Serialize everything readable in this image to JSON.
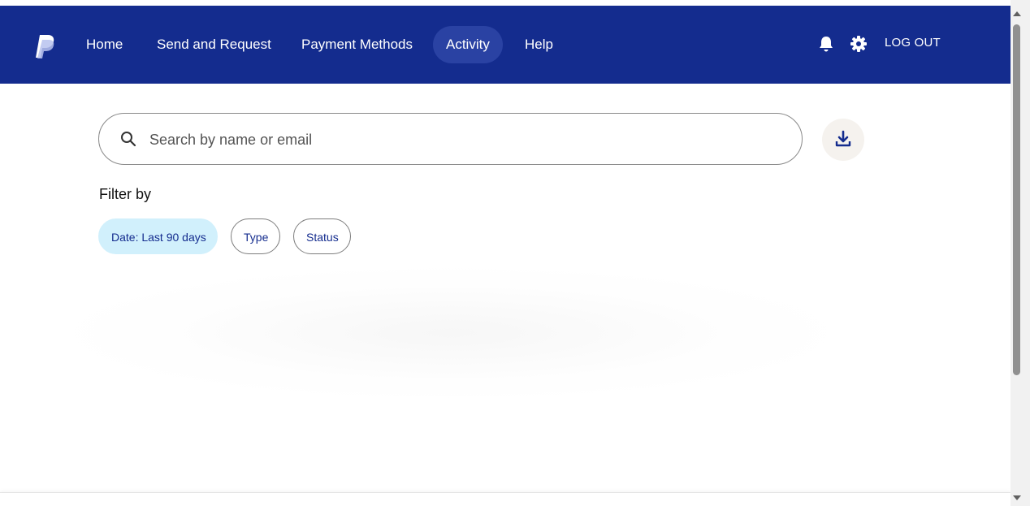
{
  "nav": {
    "logo_icon": "paypal-logo-icon",
    "items": [
      {
        "label": "Home"
      },
      {
        "label": "Send and Request"
      },
      {
        "label": "Payment Methods"
      },
      {
        "label": "Activity",
        "active": true
      },
      {
        "label": "Help"
      }
    ],
    "notification_icon": "bell-icon",
    "settings_icon": "gear-icon",
    "logout_label": "LOG OUT",
    "brand_color": "#142c8e",
    "active_color": "#2a42a3"
  },
  "search": {
    "placeholder": "Search by name or email",
    "value": "",
    "icon": "search-icon"
  },
  "download": {
    "icon": "download-icon"
  },
  "filters": {
    "label": "Filter by",
    "chips": [
      {
        "label": "Date: Last 90 days",
        "selected": true
      },
      {
        "label": "Type",
        "selected": false
      },
      {
        "label": "Status",
        "selected": false
      }
    ],
    "selected_color": "#d1f0fc"
  }
}
